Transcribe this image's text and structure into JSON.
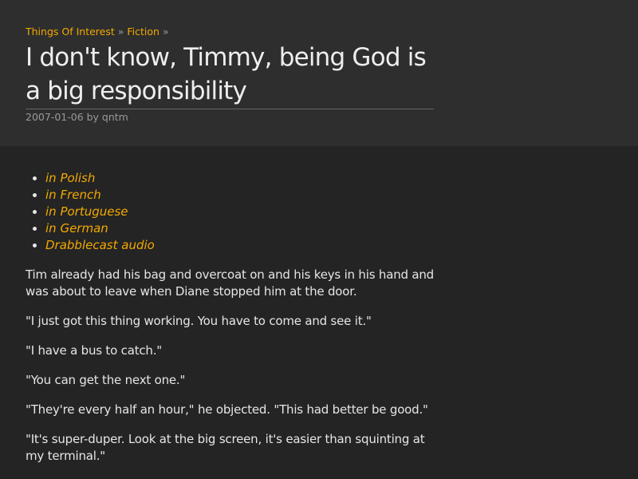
{
  "breadcrumb": {
    "items": [
      "Things Of Interest",
      "Fiction"
    ],
    "separator": "»"
  },
  "title": "I don't know, Timmy, being God is a big responsibility",
  "meta": "2007-01-06 by qntm",
  "links": [
    "in Polish",
    "in French",
    "in Portuguese",
    "in German",
    "Drabblecast audio"
  ],
  "paragraphs": [
    "Tim already had his bag and overcoat on and his keys in his hand and was about to leave when Diane stopped him at the door.",
    "\"I just got this thing working. You have to come and see it.\"",
    "\"I have a bus to catch.\"",
    "\"You can get the next one.\"",
    "\"They're every half an hour,\" he objected. \"This had better be good.\"",
    "\"It's super-duper. Look at the big screen, it's easier than squinting at my terminal.\""
  ],
  "colors": {
    "accent": "#f2a900",
    "header_bg": "#2e2e2e",
    "body_bg": "#242424"
  }
}
